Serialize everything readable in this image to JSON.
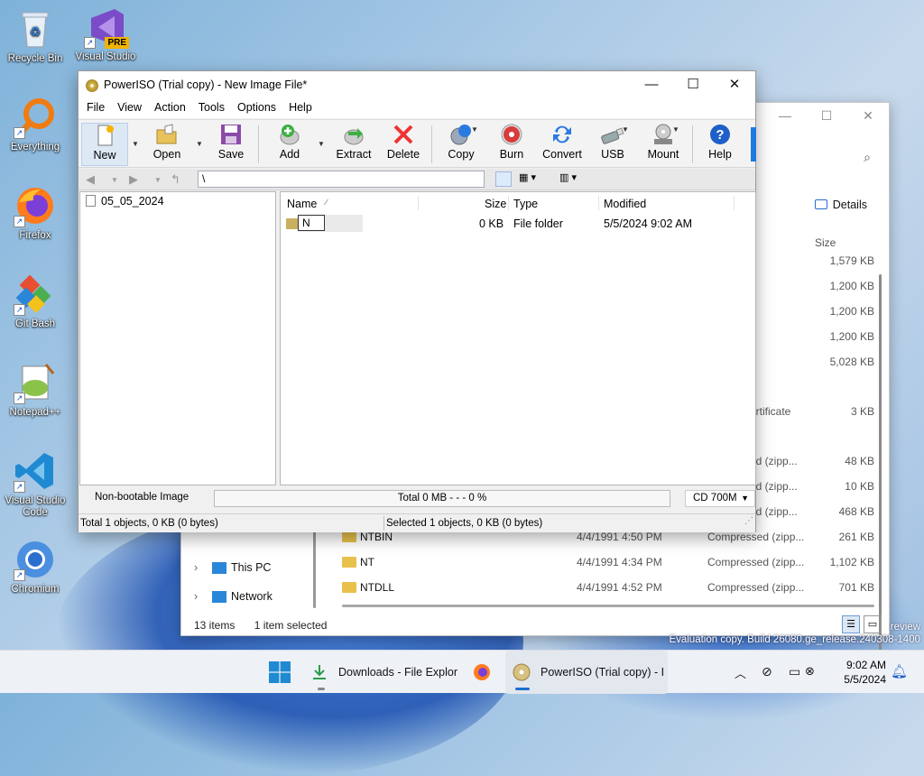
{
  "desktop": {
    "icons": [
      {
        "label": "Recycle Bin",
        "icon": "recycle-bin-icon"
      },
      {
        "label": "Visual Studio",
        "badge": "PRE",
        "icon": "visual-studio-preview-icon"
      },
      {
        "label": "Everything",
        "icon": "everything-search-icon"
      },
      {
        "label": "Firefox",
        "icon": "firefox-icon"
      },
      {
        "label": "Git Bash",
        "icon": "git-bash-icon"
      },
      {
        "label": "Notepad++",
        "icon": "notepad-plus-plus-icon"
      },
      {
        "label": "Visual Studio Code",
        "icon": "vscode-icon"
      },
      {
        "label": "Chromium",
        "icon": "chromium-icon"
      }
    ],
    "watermark": [
      "review",
      "Evaluation copy. Build 26080.ge_release.240308-1400"
    ]
  },
  "explorer": {
    "details_label": "Details",
    "size_header": "Size",
    "rows": [
      {
        "name": "",
        "date": "",
        "type": "n",
        "size": "1,579 KB"
      },
      {
        "name": "",
        "date": "",
        "type": "",
        "size": "1,200 KB"
      },
      {
        "name": "",
        "date": "",
        "type": "",
        "size": "1,200 KB"
      },
      {
        "name": "",
        "date": "",
        "type": "",
        "size": "1,200 KB"
      },
      {
        "name": "",
        "date": "",
        "type": "n",
        "size": "5,028 KB"
      },
      {
        "name": "",
        "date": "",
        "type": "ertificate",
        "size": "3 KB"
      },
      {
        "name": "",
        "date": "",
        "type": "ed (zipp...",
        "size": "48 KB"
      },
      {
        "name": "",
        "date": "",
        "type": "ed (zipp...",
        "size": "10 KB"
      },
      {
        "name": "",
        "date": "",
        "type": "ed (zipp...",
        "size": "468 KB"
      },
      {
        "name": "NTBIN",
        "date": "4/4/1991 4:50 PM",
        "type": "Compressed (zipp...",
        "size": "261 KB"
      },
      {
        "name": "NT",
        "date": "4/4/1991 4:34 PM",
        "type": "Compressed (zipp...",
        "size": "1,102 KB"
      },
      {
        "name": "NTDLL",
        "date": "4/4/1991 4:52 PM",
        "type": "Compressed (zipp...",
        "size": "701 KB"
      }
    ],
    "nav": [
      {
        "label": "This PC"
      },
      {
        "label": "Network"
      }
    ],
    "status_items": "13 items",
    "status_selected": "1 item selected"
  },
  "poweriso": {
    "title": "PowerISO (Trial copy) - New Image File*",
    "menu": [
      "File",
      "View",
      "Action",
      "Tools",
      "Options",
      "Help"
    ],
    "toolbar": {
      "new": "New",
      "open": "Open",
      "save": "Save",
      "add": "Add",
      "extract": "Extract",
      "delete": "Delete",
      "copy": "Copy",
      "burn": "Burn",
      "convert": "Convert",
      "usb": "USB",
      "mount": "Mount",
      "help": "Help"
    },
    "path": "\\",
    "tree_root": "05_05_2024",
    "columns": {
      "name": "Name",
      "size": "Size",
      "type": "Type",
      "modified": "Modified"
    },
    "row": {
      "name_edit": "N",
      "size": "0 KB",
      "type": "File folder",
      "modified": "5/5/2024 9:02 AM"
    },
    "boot_status": "Non-bootable Image",
    "progress_text": "Total  0 MB   - - -  0 %",
    "media": "CD 700M",
    "status_total": "Total 1 objects, 0 KB (0 bytes)",
    "status_selected": "Selected 1 objects, 0 KB (0 bytes)"
  },
  "taskbar": {
    "downloads": "Downloads - File Explor",
    "poweriso": "PowerISO (Trial copy) - I",
    "time": "9:02 AM",
    "date": "5/5/2024"
  }
}
